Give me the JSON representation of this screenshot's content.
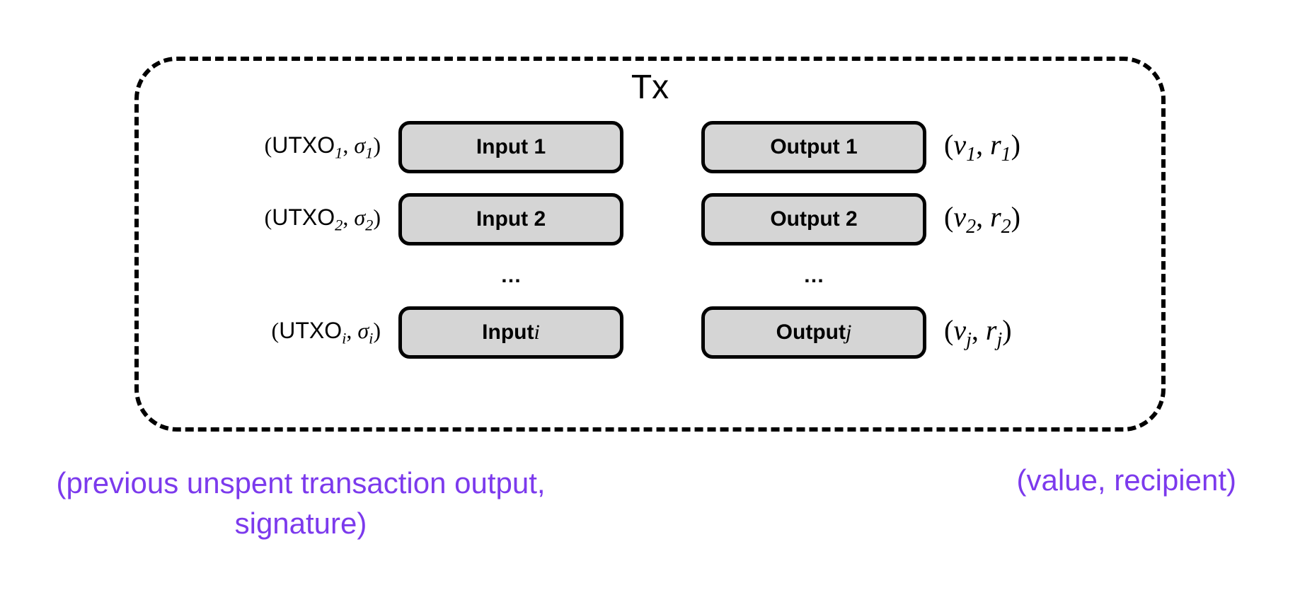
{
  "title": "Tx",
  "inputs": {
    "labels": [
      {
        "utxo": "UTXO",
        "utxo_sub": "1",
        "sigma": "σ",
        "sigma_sub": "1"
      },
      {
        "utxo": "UTXO",
        "utxo_sub": "2",
        "sigma": "σ",
        "sigma_sub": "2"
      },
      {
        "utxo": "UTXO",
        "utxo_sub": "i",
        "sigma": "σ",
        "sigma_sub": "i"
      }
    ],
    "boxes": [
      "Input 1",
      "Input 2",
      "Input i"
    ]
  },
  "outputs": {
    "boxes": [
      "Output 1",
      "Output 2",
      "Output j"
    ],
    "labels": [
      {
        "v": "v",
        "v_sub": "1",
        "r": "r",
        "r_sub": "1"
      },
      {
        "v": "v",
        "v_sub": "2",
        "r": "r",
        "r_sub": "2"
      },
      {
        "v": "v",
        "v_sub": "j",
        "r": "r",
        "r_sub": "j"
      }
    ]
  },
  "ellipsis": "…",
  "captions": {
    "left": "(previous unspent transaction output, signature)",
    "right": "(value, recipient)"
  }
}
